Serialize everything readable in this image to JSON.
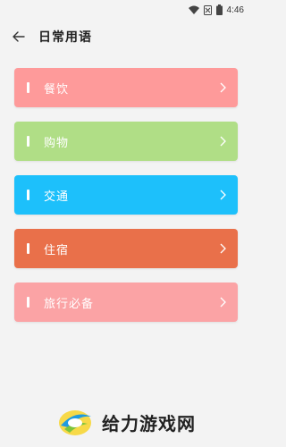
{
  "status": {
    "time": "4:46"
  },
  "header": {
    "title": "日常用语"
  },
  "categories": [
    {
      "label": "餐饮",
      "color": "#fe9a9a"
    },
    {
      "label": "购物",
      "color": "#b0de86"
    },
    {
      "label": "交通",
      "color": "#1dc0fb"
    },
    {
      "label": "住宿",
      "color": "#e9704a"
    },
    {
      "label": "旅行必备",
      "color": "#fba3a5"
    }
  ],
  "watermark": {
    "text": "给力游戏网"
  }
}
